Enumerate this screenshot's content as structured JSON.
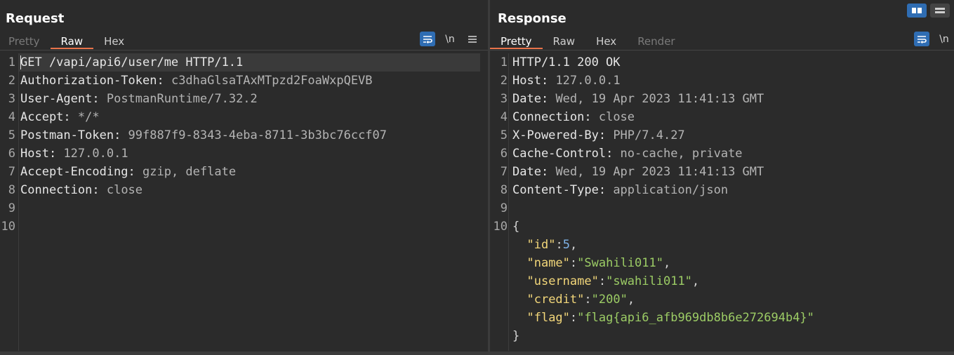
{
  "request": {
    "title": "Request",
    "tabs": [
      "Pretty",
      "Raw",
      "Hex"
    ],
    "active_tab": "Raw",
    "icons": {
      "wrap": "word-wrap-icon",
      "newline": "\\n",
      "menu": "hamburger-menu-icon"
    },
    "lines": [
      {
        "n": "1",
        "parts": [
          {
            "t": "GET /vapi/api6/user/me HTTP/1.1",
            "c": "pl"
          }
        ]
      },
      {
        "n": "2",
        "parts": [
          {
            "t": "Authorization-Token",
            "c": "hk"
          },
          {
            "t": ": ",
            "c": "pl"
          },
          {
            "t": "c3dhaGlsaTAxMTpzd2FoaWxpQEVB",
            "c": "hv"
          }
        ]
      },
      {
        "n": "3",
        "parts": [
          {
            "t": "User-Agent",
            "c": "hk"
          },
          {
            "t": ": ",
            "c": "pl"
          },
          {
            "t": "PostmanRuntime/7.32.2",
            "c": "hv"
          }
        ]
      },
      {
        "n": "4",
        "parts": [
          {
            "t": "Accept",
            "c": "hk"
          },
          {
            "t": ": ",
            "c": "pl"
          },
          {
            "t": "*/*",
            "c": "hv"
          }
        ]
      },
      {
        "n": "5",
        "parts": [
          {
            "t": "Postman-Token",
            "c": "hk"
          },
          {
            "t": ": ",
            "c": "pl"
          },
          {
            "t": "99f887f9-8343-4eba-8711-3b3bc76ccf07",
            "c": "hv"
          }
        ]
      },
      {
        "n": "6",
        "parts": [
          {
            "t": "Host",
            "c": "hk"
          },
          {
            "t": ": ",
            "c": "pl"
          },
          {
            "t": "127.0.0.1",
            "c": "hv"
          }
        ]
      },
      {
        "n": "7",
        "parts": [
          {
            "t": "Accept-Encoding",
            "c": "hk"
          },
          {
            "t": ": ",
            "c": "pl"
          },
          {
            "t": "gzip, deflate",
            "c": "hv"
          }
        ]
      },
      {
        "n": "8",
        "parts": [
          {
            "t": "Connection",
            "c": "hk"
          },
          {
            "t": ": ",
            "c": "pl"
          },
          {
            "t": "close",
            "c": "hv"
          }
        ]
      },
      {
        "n": "9",
        "parts": []
      },
      {
        "n": "10",
        "parts": []
      }
    ]
  },
  "response": {
    "title": "Response",
    "tabs": [
      "Pretty",
      "Raw",
      "Hex",
      "Render"
    ],
    "active_tab": "Pretty",
    "icons": {
      "wrap": "word-wrap-icon",
      "newline": "\\n"
    },
    "lines": [
      {
        "n": "1",
        "parts": [
          {
            "t": "HTTP/1.1 200 OK",
            "c": "pl"
          }
        ]
      },
      {
        "n": "2",
        "parts": [
          {
            "t": "Host",
            "c": "hk"
          },
          {
            "t": ": ",
            "c": "pl"
          },
          {
            "t": "127.0.0.1",
            "c": "hv"
          }
        ]
      },
      {
        "n": "3",
        "parts": [
          {
            "t": "Date",
            "c": "hk"
          },
          {
            "t": ": ",
            "c": "pl"
          },
          {
            "t": "Wed, 19 Apr 2023 11:41:13 GMT",
            "c": "hv"
          }
        ]
      },
      {
        "n": "4",
        "parts": [
          {
            "t": "Connection",
            "c": "hk"
          },
          {
            "t": ": ",
            "c": "pl"
          },
          {
            "t": "close",
            "c": "hv"
          }
        ]
      },
      {
        "n": "5",
        "parts": [
          {
            "t": "X-Powered-By",
            "c": "hk"
          },
          {
            "t": ": ",
            "c": "pl"
          },
          {
            "t": "PHP/7.4.27",
            "c": "hv"
          }
        ]
      },
      {
        "n": "6",
        "parts": [
          {
            "t": "Cache-Control",
            "c": "hk"
          },
          {
            "t": ": ",
            "c": "pl"
          },
          {
            "t": "no-cache, private",
            "c": "hv"
          }
        ]
      },
      {
        "n": "7",
        "parts": [
          {
            "t": "Date",
            "c": "hk"
          },
          {
            "t": ": ",
            "c": "pl"
          },
          {
            "t": "Wed, 19 Apr 2023 11:41:13 GMT",
            "c": "hv"
          }
        ]
      },
      {
        "n": "8",
        "parts": [
          {
            "t": "Content-Type",
            "c": "hk"
          },
          {
            "t": ": ",
            "c": "pl"
          },
          {
            "t": "application/json",
            "c": "hv"
          }
        ]
      },
      {
        "n": "9",
        "parts": []
      },
      {
        "n": "10",
        "parts": [
          {
            "t": "{",
            "c": "jp"
          }
        ]
      },
      {
        "n": "",
        "parts": [
          {
            "t": "  ",
            "c": "jp"
          },
          {
            "t": "\"id\"",
            "c": "jk"
          },
          {
            "t": ":",
            "c": "jp"
          },
          {
            "t": "5",
            "c": "jn"
          },
          {
            "t": ",",
            "c": "jp"
          }
        ]
      },
      {
        "n": "",
        "parts": [
          {
            "t": "  ",
            "c": "jp"
          },
          {
            "t": "\"name\"",
            "c": "jk"
          },
          {
            "t": ":",
            "c": "jp"
          },
          {
            "t": "\"Swahili011\"",
            "c": "js"
          },
          {
            "t": ",",
            "c": "jp"
          }
        ]
      },
      {
        "n": "",
        "parts": [
          {
            "t": "  ",
            "c": "jp"
          },
          {
            "t": "\"username\"",
            "c": "jk"
          },
          {
            "t": ":",
            "c": "jp"
          },
          {
            "t": "\"swahili011\"",
            "c": "js"
          },
          {
            "t": ",",
            "c": "jp"
          }
        ]
      },
      {
        "n": "",
        "parts": [
          {
            "t": "  ",
            "c": "jp"
          },
          {
            "t": "\"credit\"",
            "c": "jk"
          },
          {
            "t": ":",
            "c": "jp"
          },
          {
            "t": "\"200\"",
            "c": "js"
          },
          {
            "t": ",",
            "c": "jp"
          }
        ]
      },
      {
        "n": "",
        "parts": [
          {
            "t": "  ",
            "c": "jp"
          },
          {
            "t": "\"flag\"",
            "c": "jk"
          },
          {
            "t": ":",
            "c": "jp"
          },
          {
            "t": "\"flag{api6_afb969db8b6e272694b4}\"",
            "c": "js"
          }
        ]
      },
      {
        "n": "",
        "parts": [
          {
            "t": "}",
            "c": "jp"
          }
        ]
      }
    ]
  },
  "layout_buttons": {
    "split": "split-view-icon",
    "stacked": "stacked-view-icon"
  },
  "colors": {
    "accent": "#e8734a",
    "button_blue": "#2f6db3",
    "background": "#2b2b2b"
  }
}
